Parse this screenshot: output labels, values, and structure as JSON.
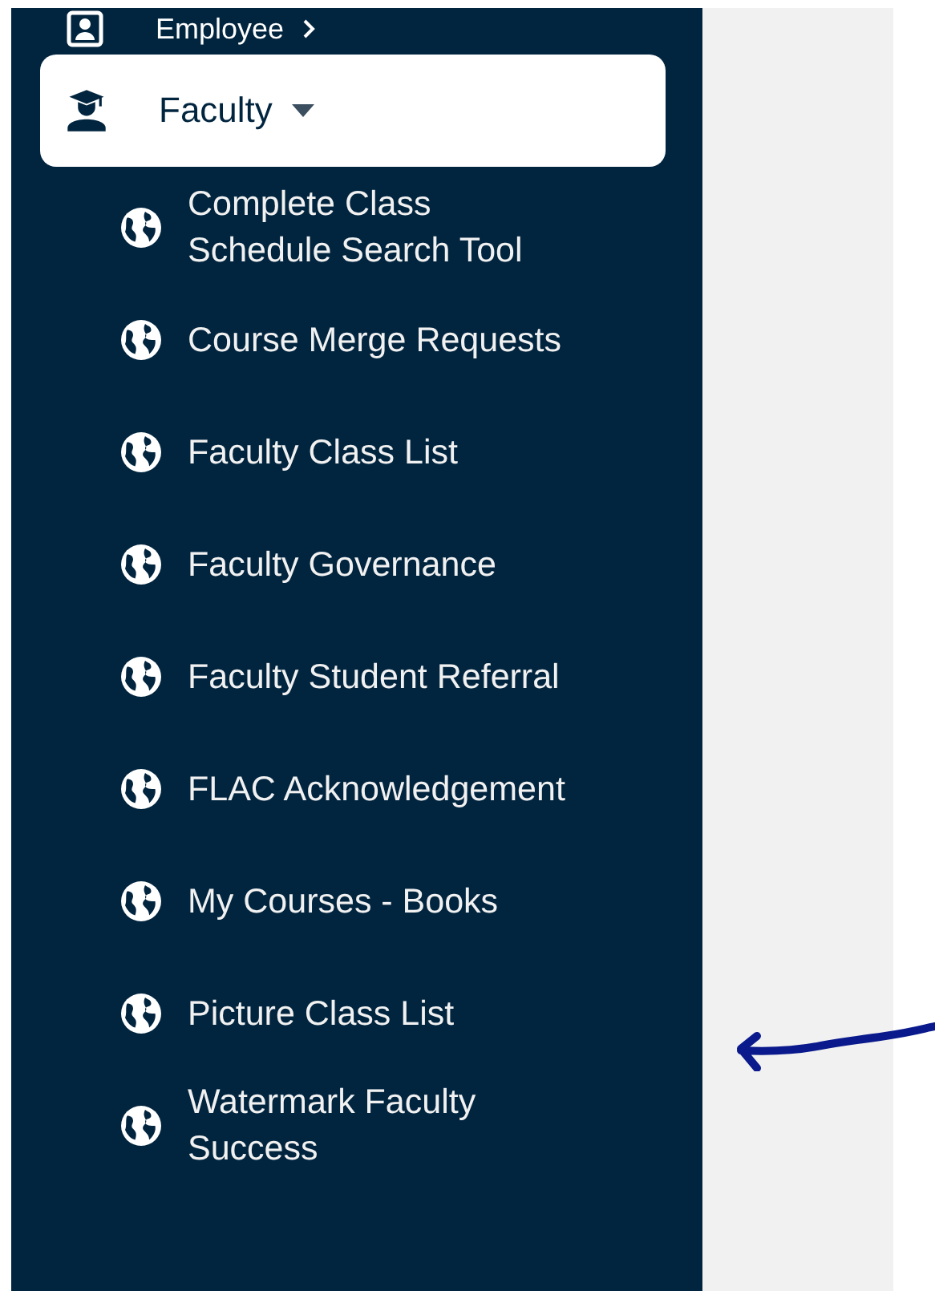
{
  "sidebar": {
    "sections": [
      {
        "label": "Employee",
        "expanded": false,
        "selected": false
      },
      {
        "label": "Faculty",
        "expanded": true,
        "selected": true,
        "children": [
          {
            "label": "Complete Class Schedule Search Tool"
          },
          {
            "label": "Course Merge Requests"
          },
          {
            "label": "Faculty Class List"
          },
          {
            "label": "Faculty Governance"
          },
          {
            "label": "Faculty Student Referral"
          },
          {
            "label": "FLAC Acknowledgement"
          },
          {
            "label": "My Courses - Books"
          },
          {
            "label": "Picture Class List"
          },
          {
            "label": "Watermark Faculty Success"
          }
        ]
      }
    ]
  }
}
